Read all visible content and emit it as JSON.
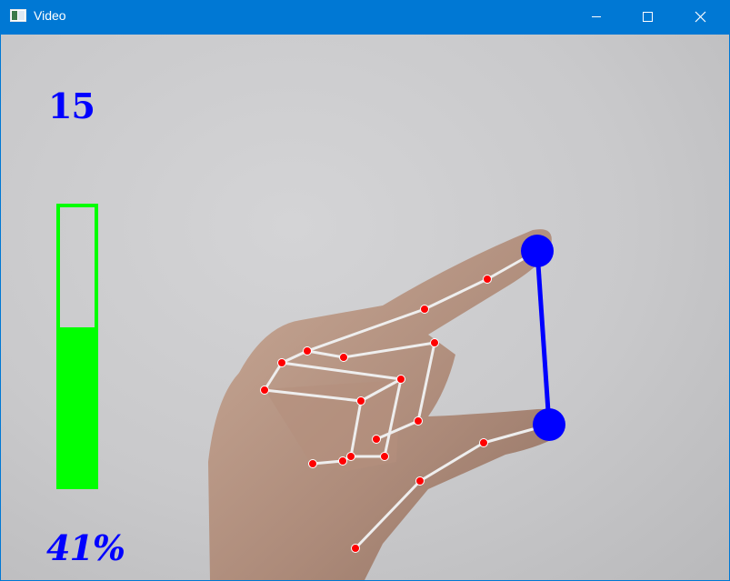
{
  "window": {
    "title": "Video",
    "accent": "#0078d4"
  },
  "icons": {
    "app": "video-window-icon",
    "minimize": "minimize-icon",
    "maximize": "maximize-icon",
    "close": "close-icon"
  },
  "overlay": {
    "fps_text": "15",
    "volume_text": "41%",
    "volume_level": 0.41,
    "bar_color": "#00ff00",
    "text_color": "#0000ff",
    "fingertip_color": "#0000ff",
    "landmark_color": "#ff0000",
    "connection_color": "#eeeeee"
  }
}
